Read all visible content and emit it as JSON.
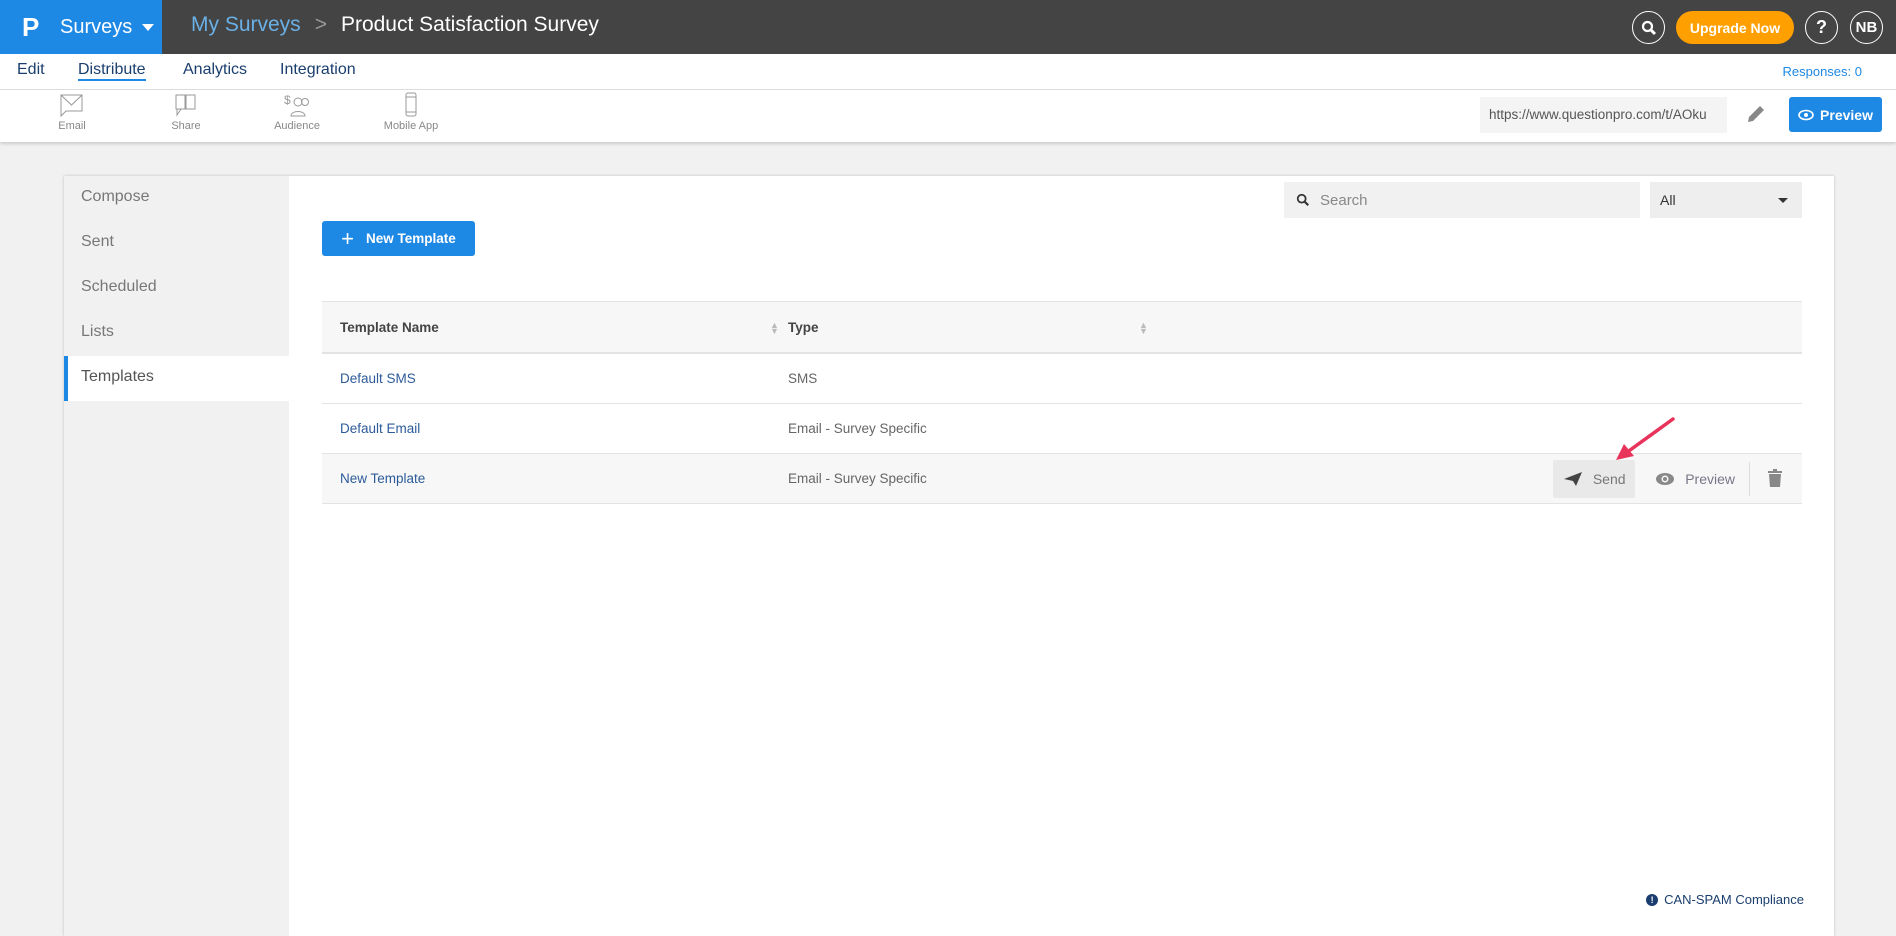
{
  "header": {
    "logo": "P",
    "app": "Surveys",
    "breadcrumb_parent": "My Surveys",
    "breadcrumb_sep": ">",
    "title": "Product Satisfaction Survey",
    "upgrade": "Upgrade Now",
    "help": "?",
    "avatar": "NB"
  },
  "nav": {
    "tabs": [
      "Edit",
      "Distribute",
      "Analytics",
      "Integration"
    ],
    "active": "Distribute",
    "responses": "Responses: 0"
  },
  "toolbar": {
    "tools": [
      "Email",
      "Share",
      "Audience",
      "Mobile App"
    ],
    "url": "https://www.questionpro.com/t/AOku",
    "preview": "Preview"
  },
  "sidebar": {
    "items": [
      "Compose",
      "Sent",
      "Scheduled",
      "Lists",
      "Templates"
    ],
    "active": "Templates"
  },
  "main": {
    "search_placeholder": "Search",
    "filter": "All",
    "new_template": "New Template",
    "columns": [
      "Template Name",
      "Type"
    ],
    "rows": [
      {
        "name": "Default SMS",
        "type": "SMS"
      },
      {
        "name": "Default Email",
        "type": "Email - Survey Specific"
      },
      {
        "name": "New Template",
        "type": "Email - Survey Specific"
      }
    ],
    "actions": {
      "send": "Send",
      "preview": "Preview"
    },
    "canspam": "CAN-SPAM Compliance",
    "canspam_icon": "!"
  },
  "colors": {
    "accent": "#1e88e5",
    "upgrade": "#ffa000",
    "topbar": "#444444",
    "annotation": "#e8335a"
  }
}
